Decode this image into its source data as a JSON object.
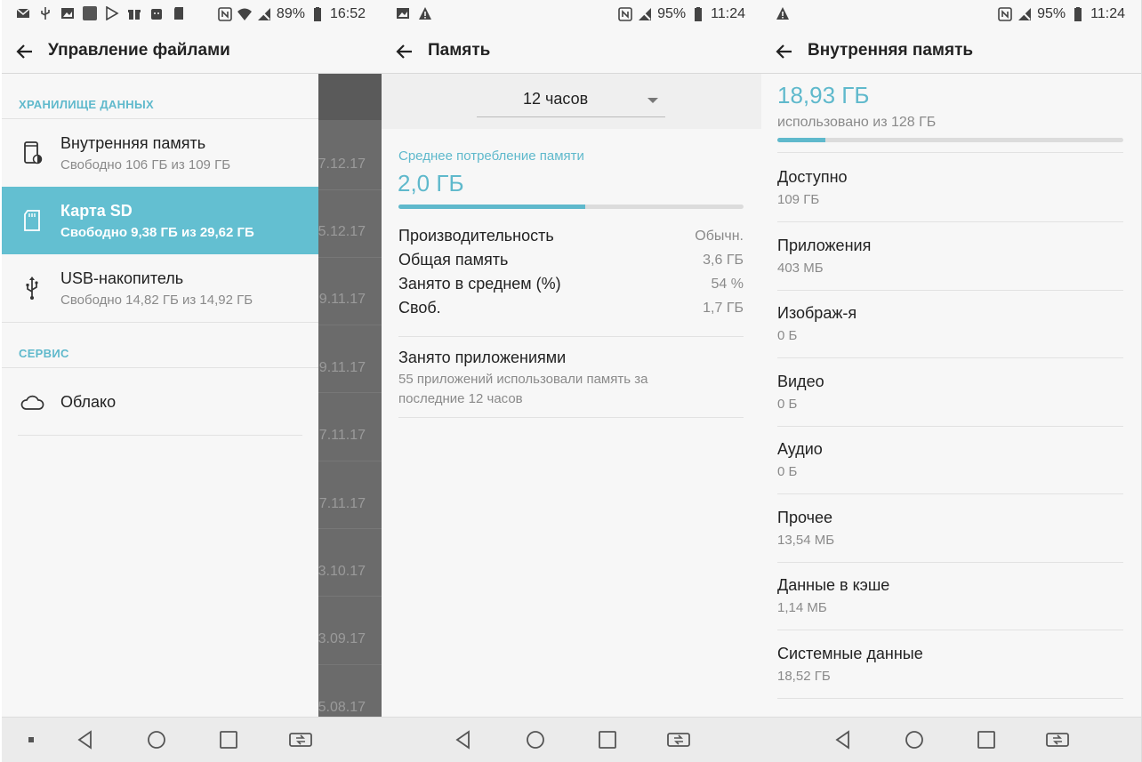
{
  "panel1": {
    "status": {
      "battery": "89%",
      "time": "16:52"
    },
    "title": "Управление файлами",
    "section_storage": "ХРАНИЛИЩЕ ДАННЫХ",
    "items": [
      {
        "label": "Внутренняя память",
        "sub": "Свободно 106 ГБ из 109 ГБ"
      },
      {
        "label": "Карта SD",
        "sub": "Свободно 9,38 ГБ из 29,62 ГБ"
      },
      {
        "label": "USB-накопитель",
        "sub": "Свободно 14,82 ГБ из 14,92 ГБ"
      }
    ],
    "section_service": "СЕРВИС",
    "cloud": "Облако",
    "background_dates": [
      "7.12.17",
      "5.12.17",
      "9.11.17",
      "9.11.17",
      "7.11.17",
      "7.11.17",
      "3.10.17",
      "3.09.17",
      "5.08.17"
    ]
  },
  "panel2": {
    "status": {
      "battery": "95%",
      "time": "11:24"
    },
    "title": "Память",
    "period": "12 часов",
    "avg_label": "Среднее потребление памяти",
    "avg_value": "2,0 ГБ",
    "avg_fraction": 0.54,
    "stats": [
      {
        "k": "Производительность",
        "v": "Обычн."
      },
      {
        "k": "Общая память",
        "v": "3,6 ГБ"
      },
      {
        "k": "Занято в среднем (%)",
        "v": "54 %"
      },
      {
        "k": "Своб.",
        "v": "1,7 ГБ"
      }
    ],
    "apps_title": "Занято приложениями",
    "apps_desc": "55 приложений использовали память за последние 12 часов"
  },
  "panel3": {
    "status": {
      "battery": "95%",
      "time": "11:24"
    },
    "title": "Внутренняя память",
    "used": "18,93 ГБ",
    "used_of": "использовано из 128 ГБ",
    "used_fraction": 0.14,
    "categories": [
      {
        "k": "Доступно",
        "v": "109 ГБ"
      },
      {
        "k": "Приложения",
        "v": "403 МБ"
      },
      {
        "k": "Изображ-я",
        "v": "0 Б"
      },
      {
        "k": "Видео",
        "v": "0 Б"
      },
      {
        "k": "Аудио",
        "v": "0 Б"
      },
      {
        "k": "Прочее",
        "v": "13,54 МБ"
      },
      {
        "k": "Данные в кэше",
        "v": "1,14 МБ"
      },
      {
        "k": "Системные данные",
        "v": "18,52 ГБ"
      }
    ]
  },
  "colors": {
    "accent": "#5fb9cc",
    "selected": "#63bfd1"
  }
}
